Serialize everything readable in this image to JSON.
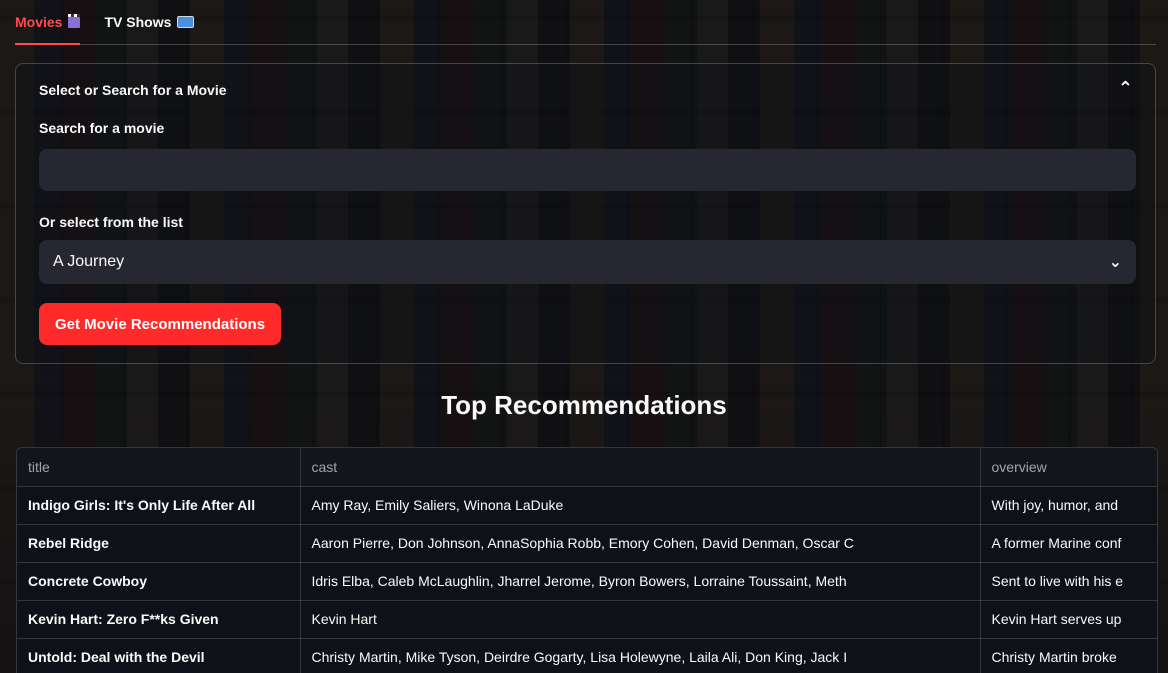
{
  "tabs": [
    {
      "label": "Movies",
      "icon": "clapperboard-icon",
      "active": true
    },
    {
      "label": "TV Shows",
      "icon": "tv-icon",
      "active": false
    }
  ],
  "expander": {
    "title": "Select or Search for a Movie",
    "search_label": "Search for a movie",
    "search_value": "",
    "select_label": "Or select from the list",
    "select_value": "A Journey",
    "button_label": "Get Movie Recommendations"
  },
  "recommendations": {
    "heading": "Top Recommendations",
    "columns": [
      "title",
      "cast",
      "overview"
    ],
    "rows": [
      {
        "title": "Indigo Girls: It's Only Life After All",
        "cast": "Amy Ray, Emily Saliers, Winona LaDuke",
        "overview": "With joy, humor, and"
      },
      {
        "title": "Rebel Ridge",
        "cast": "Aaron Pierre, Don Johnson, AnnaSophia Robb, Emory Cohen, David Denman, Oscar C",
        "overview": "A former Marine conf"
      },
      {
        "title": "Concrete Cowboy",
        "cast": "Idris Elba, Caleb McLaughlin, Jharrel Jerome, Byron Bowers, Lorraine Toussaint, Meth",
        "overview": "Sent to live with his e"
      },
      {
        "title": "Kevin Hart: Zero F**ks Given",
        "cast": "Kevin Hart",
        "overview": "Kevin Hart serves up"
      },
      {
        "title": "Untold: Deal with the Devil",
        "cast": "Christy Martin, Mike Tyson, Deirdre Gogarty, Lisa Holewyne, Laila Ali, Don King, Jack I",
        "overview": "Christy Martin broke"
      }
    ]
  },
  "colors": {
    "accent": "#ff4b4b",
    "button": "#ff2b2b",
    "input_bg": "#262730",
    "app_bg": "#0e1117"
  }
}
